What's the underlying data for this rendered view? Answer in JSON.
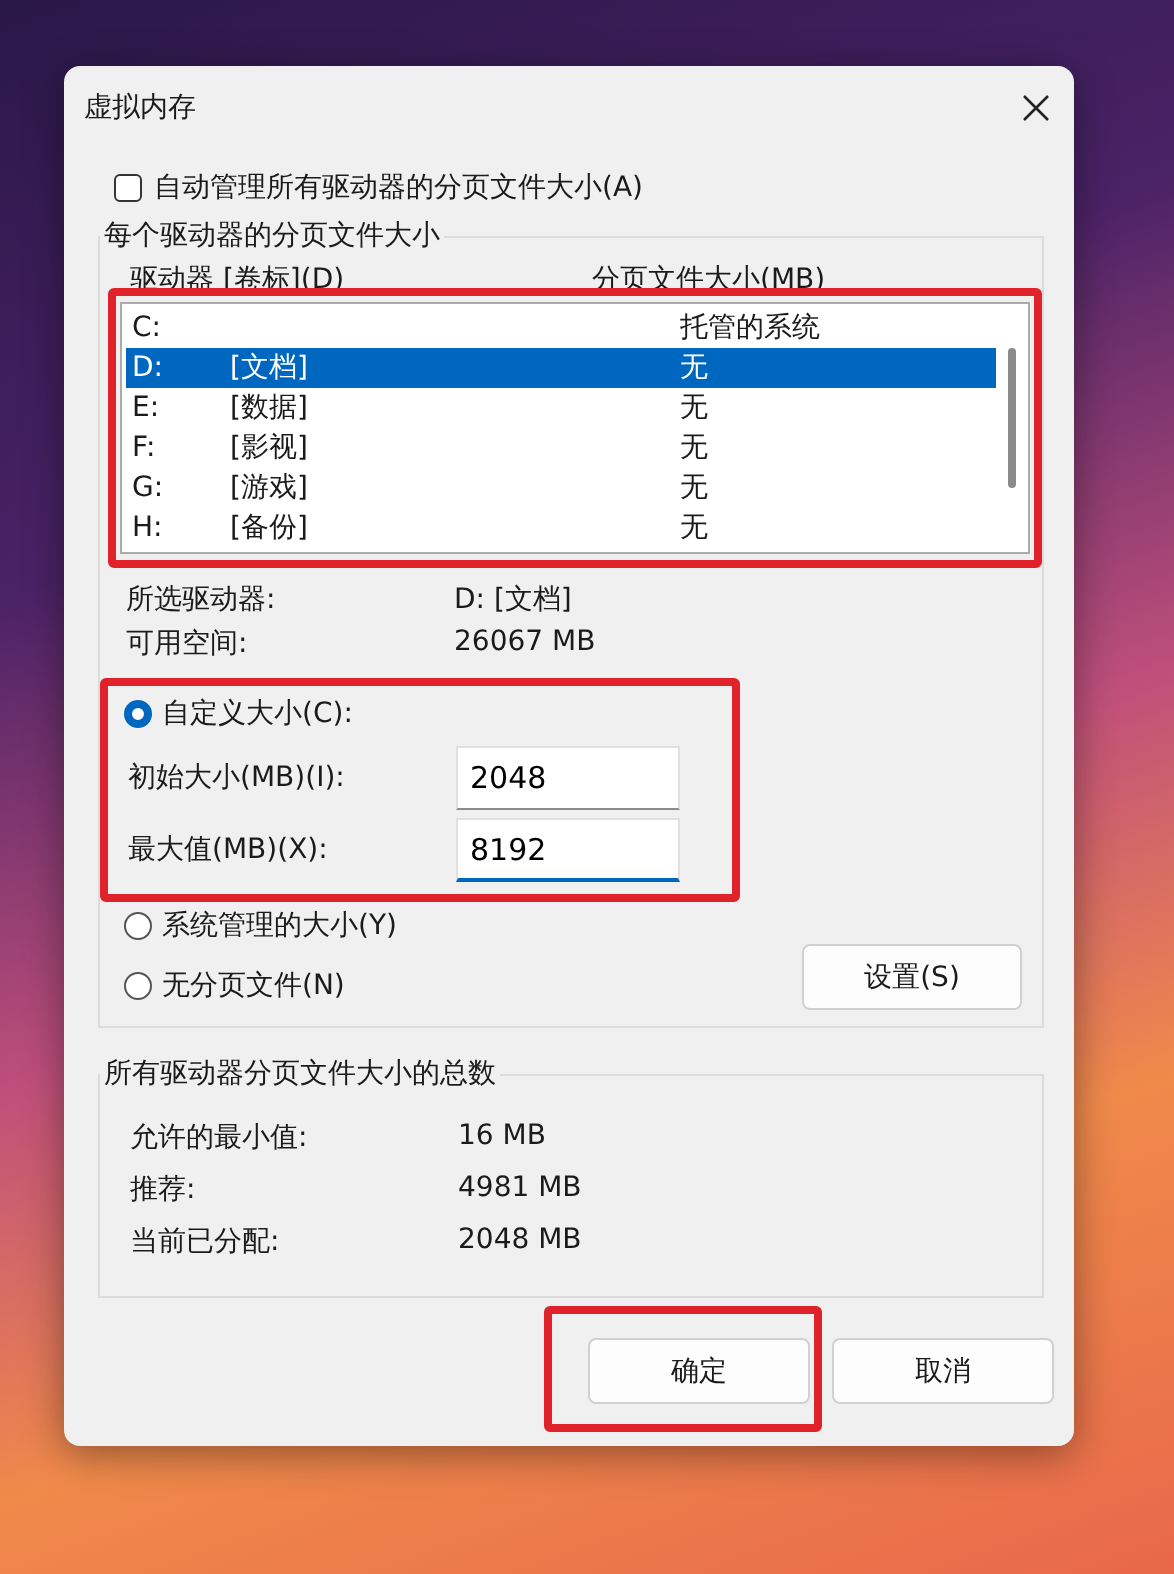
{
  "window": {
    "title": "虚拟内存"
  },
  "auto_manage": {
    "label": "自动管理所有驱动器的分页文件大小(A)",
    "checked": false
  },
  "per_drive": {
    "title": "每个驱动器的分页文件大小",
    "columns": [
      "驱动器 [卷标](D)",
      "分页文件大小(MB)"
    ],
    "highlighted": true,
    "drives": [
      {
        "drive": "C:",
        "paging": "托管的系统",
        "selected": false
      },
      {
        "drive": "D:",
        "label": "[文档]",
        "paging": "无",
        "selected": true
      },
      {
        "drive": "E:",
        "label": "[数据]",
        "paging": "无",
        "selected": false
      },
      {
        "drive": "F:",
        "label": "[影视]",
        "paging": "无",
        "selected": false
      },
      {
        "drive": "G:",
        "label": "[游戏]",
        "paging": "无",
        "selected": false
      },
      {
        "drive": "H:",
        "label": "[备份]",
        "paging": "无",
        "selected": false
      }
    ],
    "info": [
      {
        "label": "所选驱动器:",
        "value": "D:  [文档]"
      },
      {
        "label": "可用空间:",
        "value": "26067 MB"
      }
    ],
    "custom_highlighted": true,
    "options": [
      {
        "label": "自定义大小(C):",
        "selected": true
      },
      {
        "label": "系统管理的大小(Y)",
        "selected": false
      },
      {
        "label": "无分页文件(N)",
        "selected": false
      }
    ],
    "fields": [
      {
        "label": "初始大小(MB)(I):",
        "value": "2048",
        "focused": false
      },
      {
        "label": "最大值(MB)(X):",
        "value": "8192",
        "focused": true
      }
    ],
    "set_button": "设置(S)"
  },
  "totals": {
    "title": "所有驱动器分页文件大小的总数",
    "rows": [
      {
        "label": "允许的最小值:",
        "value": "16 MB"
      },
      {
        "label": "推荐:",
        "value": "4981 MB"
      },
      {
        "label": "当前已分配:",
        "value": "2048 MB"
      }
    ]
  },
  "buttons": [
    {
      "label": "确定",
      "highlighted": true
    },
    {
      "label": "取消",
      "highlighted": false
    }
  ]
}
